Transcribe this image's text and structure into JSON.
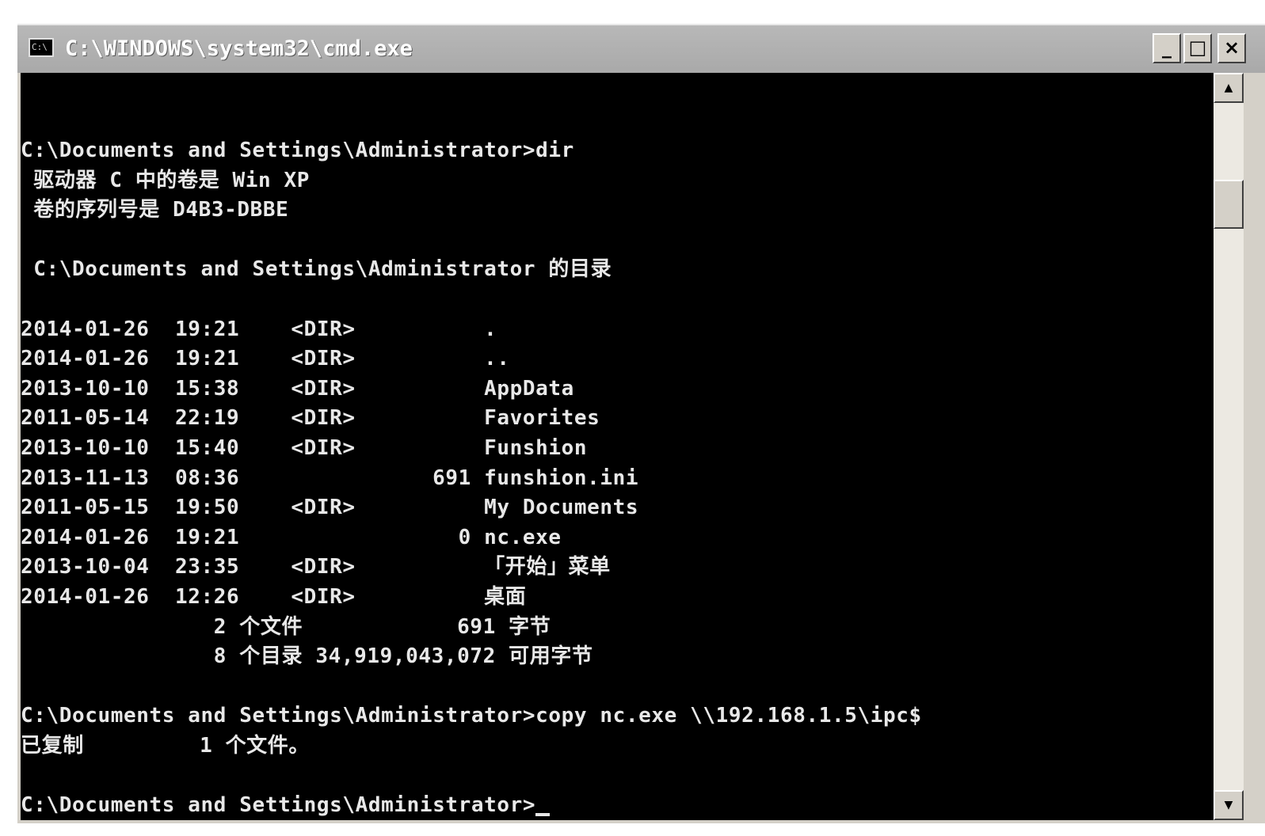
{
  "window": {
    "title": "C:\\WINDOWS\\system32\\cmd.exe",
    "icon": "cmd-console-icon",
    "icon_glyph": "C:\\",
    "controls": {
      "minimize_glyph": "_",
      "maximize_glyph": "□",
      "close_glyph": "×"
    }
  },
  "console": {
    "foreground": "#e8e8e8",
    "background": "#000000",
    "lines": [
      "C:\\Documents and Settings\\Administrator>dir",
      " 驱动器 C 中的卷是 Win XP",
      " 卷的序列号是 D4B3-DBBE",
      "",
      " C:\\Documents and Settings\\Administrator 的目录",
      "",
      "2014-01-26  19:21    <DIR>          .",
      "2014-01-26  19:21    <DIR>          ..",
      "2013-10-10  15:38    <DIR>          AppData",
      "2011-05-14  22:19    <DIR>          Favorites",
      "2013-10-10  15:40    <DIR>          Funshion",
      "2013-11-13  08:36               691 funshion.ini",
      "2011-05-15  19:50    <DIR>          My Documents",
      "2014-01-26  19:21                 0 nc.exe",
      "2013-10-04  23:35    <DIR>          「开始」菜单",
      "2014-01-26  12:26    <DIR>          桌面",
      "               2 个文件            691 字节",
      "               8 个目录 34,919,043,072 可用字节",
      "",
      "C:\\Documents and Settings\\Administrator>copy nc.exe \\\\192.168.1.5\\ipc$",
      "已复制         1 个文件。",
      "",
      "C:\\Documents and Settings\\Administrator>"
    ]
  },
  "scrollbar": {
    "up_glyph": "▲",
    "down_glyph": "▼",
    "position_fraction": 0.12
  }
}
